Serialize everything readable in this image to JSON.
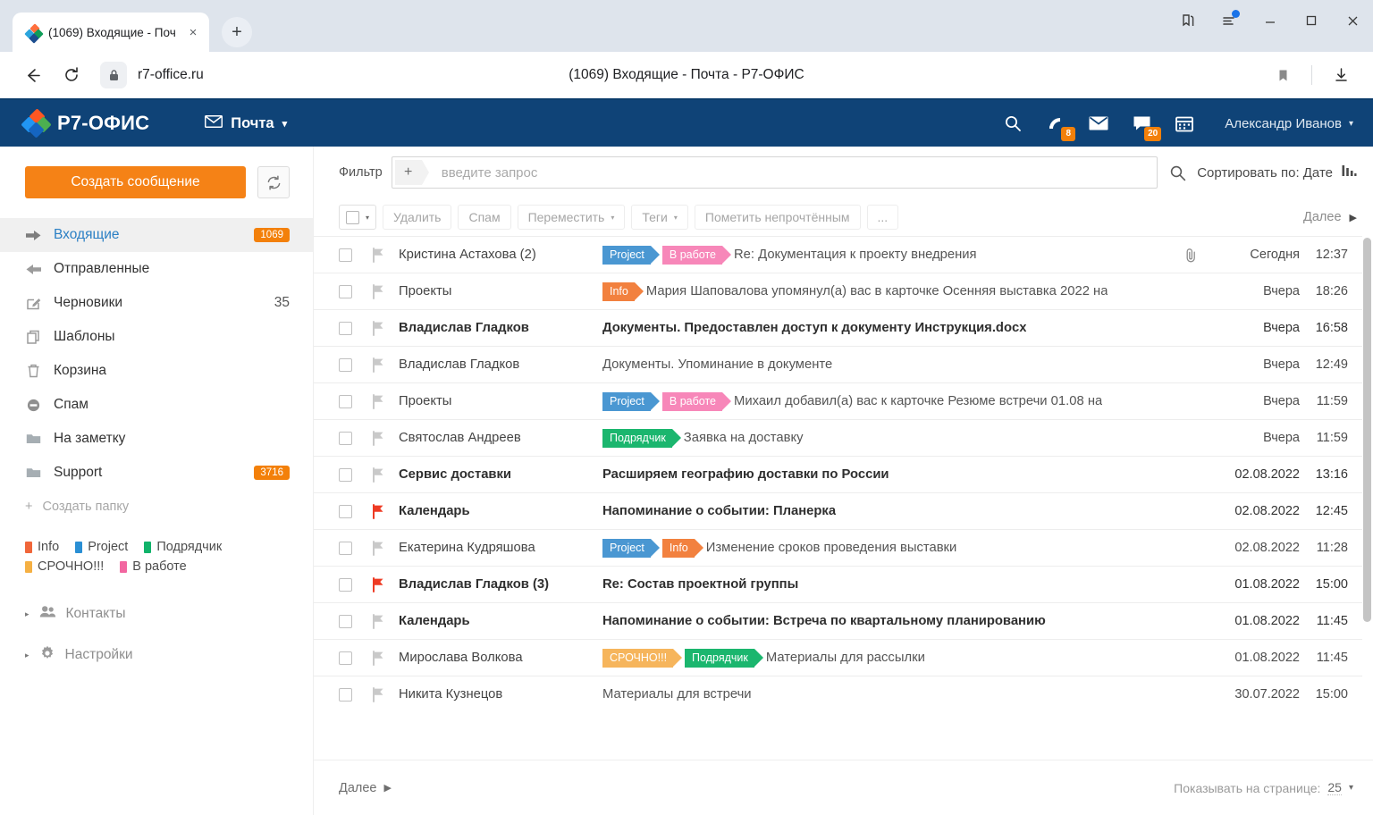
{
  "browser": {
    "tab": {
      "title": "(1069) Входящие - Поч",
      "favicon": "r7-logo-icon",
      "close": "×"
    },
    "newtab_label": "+",
    "window_controls": [
      {
        "name": "collections-icon",
        "label": ""
      },
      {
        "name": "browser-settings-icon",
        "label": ""
      },
      {
        "name": "minimize-button",
        "label": "—"
      },
      {
        "name": "maximize-button",
        "label": "□"
      },
      {
        "name": "close-button",
        "label": "×"
      }
    ],
    "back_label": "←",
    "reload_label": "⟳",
    "lock_icon": "lock-icon",
    "url": "r7-office.ru",
    "page_title": "(1069) Входящие - Почта - Р7-ОФИС",
    "bookmark_icon": "bookmark-icon",
    "download_icon": "download-icon"
  },
  "header": {
    "brand": "Р7-ОФИС",
    "module": "Почта",
    "module_caret": "▾",
    "icons": [
      {
        "name": "search-icon",
        "badge": ""
      },
      {
        "name": "feed-icon",
        "badge": "8"
      },
      {
        "name": "mail-icon",
        "badge": ""
      },
      {
        "name": "chat-icon",
        "badge": "20"
      },
      {
        "name": "calendar-icon",
        "badge": ""
      }
    ],
    "user": "Александр Иванов",
    "user_caret": "▾"
  },
  "sidebar": {
    "compose": "Создать сообщение",
    "refresh_icon": "refresh-icon",
    "folders": [
      {
        "label": "Входящие",
        "icon": "inbox-arrow-icon",
        "badge": "1069",
        "badge_style": "orange",
        "active": true
      },
      {
        "label": "Отправленные",
        "icon": "sent-arrow-icon",
        "badge": "",
        "badge_style": "none",
        "active": false
      },
      {
        "label": "Черновики",
        "icon": "draft-pencil-icon",
        "badge": "35",
        "badge_style": "plain",
        "active": false
      },
      {
        "label": "Шаблоны",
        "icon": "templates-icon",
        "badge": "",
        "badge_style": "none",
        "active": false
      },
      {
        "label": "Корзина",
        "icon": "trash-icon",
        "badge": "",
        "badge_style": "none",
        "active": false
      },
      {
        "label": "Спам",
        "icon": "spam-icon",
        "badge": "",
        "badge_style": "none",
        "active": false
      },
      {
        "label": "На заметку",
        "icon": "folder-icon",
        "badge": "",
        "badge_style": "none",
        "active": false
      },
      {
        "label": "Support",
        "icon": "folder-icon",
        "badge": "3716",
        "badge_style": "orange",
        "active": false
      }
    ],
    "new_folder": "Создать папку",
    "new_folder_icon": "plus-icon",
    "tags": [
      {
        "label": "Info",
        "color": "#f0663a"
      },
      {
        "label": "Project",
        "color": "#2a8fd4"
      },
      {
        "label": "Подрядчик",
        "color": "#11b36a"
      },
      {
        "label": "СРОЧНО!!!",
        "color": "#f5b043"
      },
      {
        "label": "В работе",
        "color": "#f266a0"
      }
    ],
    "nav": [
      {
        "label": "Контакты",
        "icon": "contacts-icon",
        "caret": "▸"
      },
      {
        "label": "Настройки",
        "icon": "gear-icon",
        "caret": "▸"
      }
    ]
  },
  "filterbar": {
    "label": "Фильтр",
    "plus": "+",
    "placeholder": "введите запрос",
    "search_icon": "search-icon",
    "sort_label": "Сортировать по: Дате",
    "sort_icon": "sort-bars-icon"
  },
  "toolbar": {
    "select_caret": "▾",
    "buttons": [
      {
        "label": "Удалить",
        "caret": ""
      },
      {
        "label": "Спам",
        "caret": ""
      },
      {
        "label": "Переместить",
        "caret": "▾"
      },
      {
        "label": "Теги",
        "caret": "▾"
      },
      {
        "label": "Пометить непрочтённым",
        "caret": ""
      },
      {
        "label": "...",
        "caret": ""
      }
    ],
    "next_label": "Далее",
    "next_caret": "▶"
  },
  "messages": [
    {
      "from": "Кристина Астахова (2)",
      "subject": "Re: Документация к проекту внедрения",
      "date": "Сегодня",
      "time": "12:37",
      "unread": false,
      "flag": "grey",
      "attach": true,
      "chips": [
        {
          "label": "Project",
          "color": "#4a97d2"
        },
        {
          "label": "В работе",
          "color": "#f787b9"
        }
      ]
    },
    {
      "from": "Проекты",
      "subject": "Мария Шаповалова упомянул(а) вас в карточке Осенняя выставка 2022 на",
      "date": "Вчера",
      "time": "18:26",
      "unread": false,
      "flag": "grey",
      "attach": false,
      "chips": [
        {
          "label": "Info",
          "color": "#f2813f"
        }
      ]
    },
    {
      "from": "Владислав Гладков",
      "subject": "Документы. Предоставлен доступ к документу Инструкция.docx",
      "date": "Вчера",
      "time": "16:58",
      "unread": true,
      "flag": "grey",
      "attach": false,
      "chips": []
    },
    {
      "from": "Владислав Гладков",
      "subject": "Документы. Упоминание в документе",
      "date": "Вчера",
      "time": "12:49",
      "unread": false,
      "flag": "grey",
      "attach": false,
      "chips": []
    },
    {
      "from": "Проекты",
      "subject": "Михаил добавил(а) вас к карточке Резюме встречи 01.08 на",
      "date": "Вчера",
      "time": "11:59",
      "unread": false,
      "flag": "grey",
      "attach": false,
      "chips": [
        {
          "label": "Project",
          "color": "#4a97d2"
        },
        {
          "label": "В работе",
          "color": "#f787b9"
        }
      ]
    },
    {
      "from": "Святослав Андреев",
      "subject": "Заявка на доставку",
      "date": "Вчера",
      "time": "11:59",
      "unread": false,
      "flag": "grey",
      "attach": false,
      "chips": [
        {
          "label": "Подрядчик",
          "color": "#1bb66e"
        }
      ]
    },
    {
      "from": "Сервис доставки",
      "subject": "Расширяем географию доставки по России",
      "date": "02.08.2022",
      "time": "13:16",
      "unread": true,
      "flag": "grey",
      "attach": false,
      "chips": []
    },
    {
      "from": "Календарь",
      "subject": "Напоминание о событии: Планерка",
      "date": "02.08.2022",
      "time": "12:45",
      "unread": true,
      "flag": "red",
      "attach": false,
      "chips": []
    },
    {
      "from": "Екатерина Кудряшова",
      "subject": "Изменение сроков проведения выставки",
      "date": "02.08.2022",
      "time": "11:28",
      "unread": false,
      "flag": "grey",
      "attach": false,
      "chips": [
        {
          "label": "Project",
          "color": "#4a97d2"
        },
        {
          "label": "Info",
          "color": "#f2813f"
        }
      ]
    },
    {
      "from": "Владислав Гладков (3)",
      "subject": "Re: Состав проектной группы",
      "date": "01.08.2022",
      "time": "15:00",
      "unread": true,
      "flag": "red",
      "attach": false,
      "chips": []
    },
    {
      "from": "Календарь",
      "subject": "Напоминание о событии: Встреча по квартальному планированию",
      "date": "01.08.2022",
      "time": "11:45",
      "unread": true,
      "flag": "grey",
      "attach": false,
      "chips": []
    },
    {
      "from": "Мирослава Волкова",
      "subject": "Материалы для рассылки",
      "date": "01.08.2022",
      "time": "11:45",
      "unread": false,
      "flag": "grey",
      "attach": false,
      "chips": [
        {
          "label": "СРОЧНО!!!",
          "color": "#f6b55c"
        },
        {
          "label": "Подрядчик",
          "color": "#1bb66e"
        }
      ]
    },
    {
      "from": "Никита Кузнецов",
      "subject": "Материалы для встречи",
      "date": "30.07.2022",
      "time": "15:00",
      "unread": false,
      "flag": "grey",
      "attach": false,
      "chips": []
    }
  ],
  "footer": {
    "more_label": "Далее",
    "more_caret": "▶",
    "perpage_label": "Показывать на странице:",
    "perpage_value": "25",
    "perpage_caret": "▾"
  }
}
